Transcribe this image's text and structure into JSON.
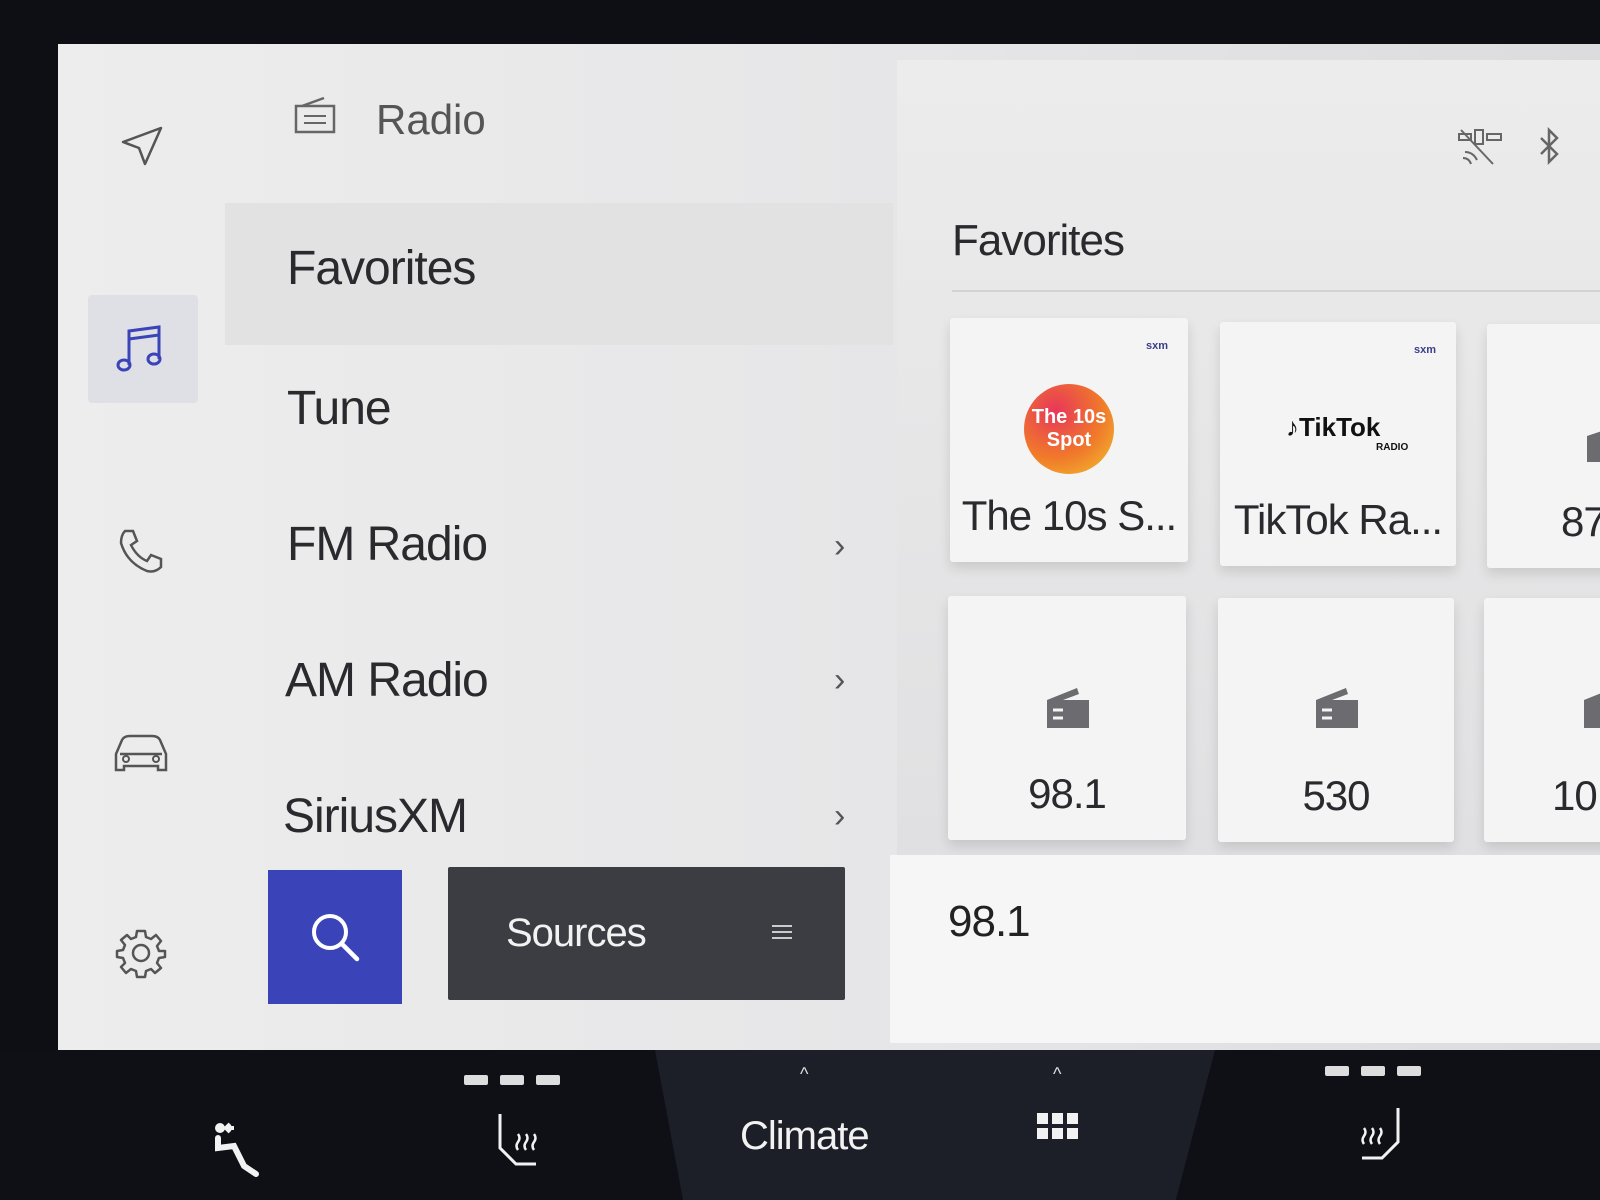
{
  "header": {
    "title": "Radio",
    "icon": "radio-icon"
  },
  "rail": [
    {
      "name": "navigation",
      "icon": "navigation-arrow-icon"
    },
    {
      "name": "media",
      "icon": "music-note-icon",
      "selected": true
    },
    {
      "name": "phone",
      "icon": "phone-icon"
    },
    {
      "name": "vehicle",
      "icon": "car-icon"
    },
    {
      "name": "settings",
      "icon": "gear-icon"
    }
  ],
  "menu": {
    "items": [
      {
        "label": "Favorites",
        "selected": true,
        "chevron": false
      },
      {
        "label": "Tune",
        "chevron": false
      },
      {
        "label": "FM Radio",
        "chevron": true
      },
      {
        "label": "AM Radio",
        "chevron": true
      },
      {
        "label": "SiriusXM",
        "chevron": true
      }
    ],
    "chevron_glyph": "›"
  },
  "search_button": {
    "icon": "search-icon",
    "color": "#3a44b8"
  },
  "sources_button": {
    "label": "Sources",
    "icon": "menu-lines-icon"
  },
  "status_icons": [
    "satellite-off-icon",
    "bluetooth-icon"
  ],
  "favorites": {
    "title": "Favorites",
    "cards": [
      {
        "label": "The 10s S...",
        "logo": "The 10s Spot",
        "badge": "sxm"
      },
      {
        "label": "TikTok Ra...",
        "logo": "TikTok",
        "logo_sub": "RADIO",
        "badge": "sxm"
      },
      {
        "label": "87",
        "icon": "radio-icon"
      },
      {
        "label": "98.1",
        "icon": "radio-icon"
      },
      {
        "label": "530",
        "icon": "radio-icon"
      },
      {
        "label": "10",
        "icon": "radio-icon"
      }
    ]
  },
  "now_playing": {
    "station": "98.1"
  },
  "bottom_bar": {
    "climate_label": "Climate",
    "caret": "^",
    "items": [
      "recline-seat-icon",
      "heated-seat-left-icon",
      "climate",
      "app-grid-icon",
      "heated-seat-right-icon"
    ]
  }
}
